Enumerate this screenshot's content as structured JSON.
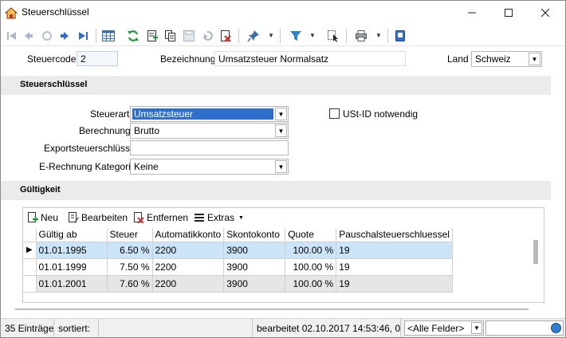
{
  "window": {
    "title": "Steuerschlüssel"
  },
  "toolbar": {
    "icons": [
      "first-icon",
      "previous-icon",
      "refresh-disabled-icon",
      "next-icon",
      "last-icon",
      "table-icon",
      "refresh-icon",
      "new-icon",
      "copy-icon",
      "save-icon",
      "undo-icon",
      "delete-icon",
      "pin-icon",
      "filter-icon",
      "select-icon",
      "print-icon",
      "info-icon"
    ]
  },
  "header": {
    "steuercode_label": "Steuercode",
    "steuercode_value": "2",
    "bezeichnung_label": "Bezeichnung",
    "bezeichnung_value": "Umsatzsteuer Normalsatz",
    "land_label": "Land",
    "land_value": "Schweiz"
  },
  "section_steuerschluessel": {
    "title": "Steuerschlüssel",
    "steuerart_label": "Steuerart",
    "steuerart_value": "Umsatzsteuer",
    "berechnung_label": "Berechnung",
    "berechnung_value": "Brutto",
    "export_label": "Exportsteuerschlüssel",
    "export_value": "",
    "erechnung_label": "E-Rechnung Kategorie",
    "erechnung_value": "Keine",
    "ustid_label": "USt-ID notwendig",
    "ustid_checked": false
  },
  "section_gueltigkeit": {
    "title": "Gültigkeit",
    "toolbar": {
      "neu": "Neu",
      "bearbeiten": "Bearbeiten",
      "entfernen": "Entfernen",
      "extras": "Extras"
    },
    "columns": [
      "Gültig ab",
      "Steuer",
      "Automatikkonto",
      "Skontokonto",
      "Quote",
      "Pauschalsteuerschluessel"
    ],
    "rows": [
      [
        "01.01.1995",
        "6.50 %",
        "2200",
        "3900",
        "100.00 %",
        "19"
      ],
      [
        "01.01.1999",
        "7.50 %",
        "2200",
        "3900",
        "100.00 %",
        "19"
      ],
      [
        "01.01.2001",
        "7.60 %",
        "2200",
        "3900",
        "100.00 %",
        "19"
      ]
    ]
  },
  "statusbar": {
    "count": "35 Einträge",
    "sorted": "sortiert:",
    "edited": "bearbeitet 02.10.2017 14:53:46,  0",
    "field_filter": "<Alle Felder>"
  }
}
